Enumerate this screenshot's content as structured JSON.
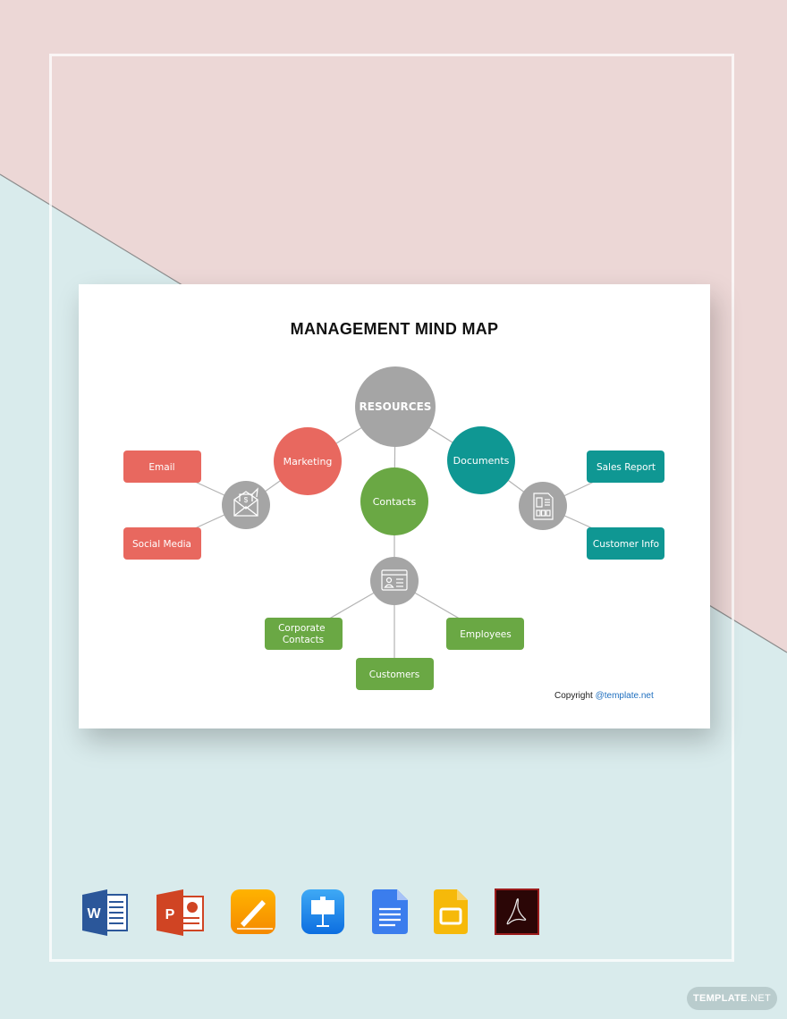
{
  "diagram": {
    "title": "MANAGEMENT MIND MAP",
    "root": {
      "label": "RESOURCES",
      "color": "#a5a5a5"
    },
    "branches": [
      {
        "label": "Marketing",
        "color": "#e8685f",
        "hub_icon": "envelope-icon",
        "children": [
          "Email",
          "Social Media"
        ]
      },
      {
        "label": "Documents",
        "color": "#0f9793",
        "hub_icon": "document-icon",
        "children": [
          "Sales Report",
          "Customer Info"
        ]
      },
      {
        "label": "Contacts",
        "color": "#6aa844",
        "hub_icon": "contact-card-icon",
        "children": [
          "Corporate Contacts",
          "Customers",
          "Employees"
        ]
      }
    ],
    "hub_color": "#a5a5a5",
    "line_color": "#b3b3b3"
  },
  "copyright": {
    "label": "Copyright ",
    "link": "@template.net"
  },
  "formats": [
    {
      "name": "Microsoft Word",
      "icon": "word-icon"
    },
    {
      "name": "Microsoft PowerPoint",
      "icon": "powerpoint-icon"
    },
    {
      "name": "Apple Pages",
      "icon": "pages-icon"
    },
    {
      "name": "Apple Keynote",
      "icon": "keynote-icon"
    },
    {
      "name": "Google Docs",
      "icon": "google-docs-icon"
    },
    {
      "name": "Google Slides",
      "icon": "google-slides-icon"
    },
    {
      "name": "Adobe PDF",
      "icon": "adobe-pdf-icon"
    }
  ],
  "badge": {
    "bold": "TEMPLATE",
    "light": ".NET"
  },
  "background": {
    "top_color": "#ecd7d6",
    "bottom_color": "#d9ebec"
  }
}
